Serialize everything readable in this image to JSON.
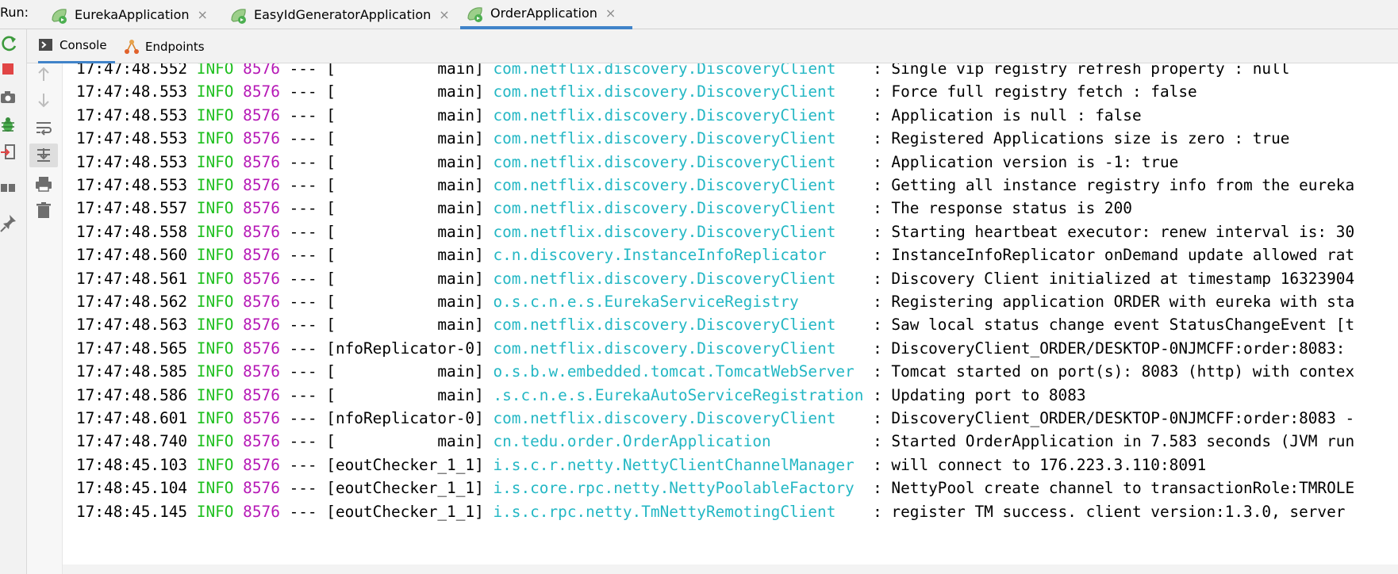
{
  "run_bar": {
    "label": "Run:",
    "tabs": [
      {
        "label": "EurekaApplication",
        "close": "×",
        "icon": "spring-boot-app-icon"
      },
      {
        "label": "EasyIdGeneratorApplication",
        "close": "×",
        "icon": "spring-boot-app-icon"
      },
      {
        "label": "OrderApplication",
        "close": "×",
        "icon": "spring-boot-app-icon",
        "active": true
      }
    ]
  },
  "sub_tabs": [
    {
      "label": "Console",
      "icon": "console-icon",
      "active": true
    },
    {
      "label": "Endpoints",
      "icon": "endpoints-icon"
    }
  ],
  "left_toolbar": [
    "rerun-icon",
    "stop-icon",
    "camera-icon",
    "debug-icon",
    "exit-icon",
    "layout-icon",
    "pin-icon"
  ],
  "console_toolbar": [
    "up-arrow-icon",
    "down-arrow-icon",
    "soft-wrap-icon",
    "scroll-to-end-icon",
    "print-icon",
    "trash-icon"
  ],
  "colors": {
    "accent": "#4083c9",
    "log_level": "#1ebf1e",
    "pid": "#b618b6",
    "logger": "#23b7c4"
  },
  "console": {
    "lines": [
      {
        "time": "17:47:48.552",
        "level": "INFO",
        "pid": "8576",
        "sep": "---",
        "thread": "[           main]",
        "logger": "com.netflix.discovery.DiscoveryClient    ",
        "message": ": Single vip registry refresh property : null"
      },
      {
        "time": "17:47:48.553",
        "level": "INFO",
        "pid": "8576",
        "sep": "---",
        "thread": "[           main]",
        "logger": "com.netflix.discovery.DiscoveryClient    ",
        "message": ": Force full registry fetch : false"
      },
      {
        "time": "17:47:48.553",
        "level": "INFO",
        "pid": "8576",
        "sep": "---",
        "thread": "[           main]",
        "logger": "com.netflix.discovery.DiscoveryClient    ",
        "message": ": Application is null : false"
      },
      {
        "time": "17:47:48.553",
        "level": "INFO",
        "pid": "8576",
        "sep": "---",
        "thread": "[           main]",
        "logger": "com.netflix.discovery.DiscoveryClient    ",
        "message": ": Registered Applications size is zero : true"
      },
      {
        "time": "17:47:48.553",
        "level": "INFO",
        "pid": "8576",
        "sep": "---",
        "thread": "[           main]",
        "logger": "com.netflix.discovery.DiscoveryClient    ",
        "message": ": Application version is -1: true"
      },
      {
        "time": "17:47:48.553",
        "level": "INFO",
        "pid": "8576",
        "sep": "---",
        "thread": "[           main]",
        "logger": "com.netflix.discovery.DiscoveryClient    ",
        "message": ": Getting all instance registry info from the eureka"
      },
      {
        "time": "17:47:48.557",
        "level": "INFO",
        "pid": "8576",
        "sep": "---",
        "thread": "[           main]",
        "logger": "com.netflix.discovery.DiscoveryClient    ",
        "message": ": The response status is 200"
      },
      {
        "time": "17:47:48.558",
        "level": "INFO",
        "pid": "8576",
        "sep": "---",
        "thread": "[           main]",
        "logger": "com.netflix.discovery.DiscoveryClient    ",
        "message": ": Starting heartbeat executor: renew interval is: 30"
      },
      {
        "time": "17:47:48.560",
        "level": "INFO",
        "pid": "8576",
        "sep": "---",
        "thread": "[           main]",
        "logger": "c.n.discovery.InstanceInfoReplicator     ",
        "message": ": InstanceInfoReplicator onDemand update allowed rat"
      },
      {
        "time": "17:47:48.561",
        "level": "INFO",
        "pid": "8576",
        "sep": "---",
        "thread": "[           main]",
        "logger": "com.netflix.discovery.DiscoveryClient    ",
        "message": ": Discovery Client initialized at timestamp 16323904"
      },
      {
        "time": "17:47:48.562",
        "level": "INFO",
        "pid": "8576",
        "sep": "---",
        "thread": "[           main]",
        "logger": "o.s.c.n.e.s.EurekaServiceRegistry        ",
        "message": ": Registering application ORDER with eureka with sta"
      },
      {
        "time": "17:47:48.563",
        "level": "INFO",
        "pid": "8576",
        "sep": "---",
        "thread": "[           main]",
        "logger": "com.netflix.discovery.DiscoveryClient    ",
        "message": ": Saw local status change event StatusChangeEvent [t"
      },
      {
        "time": "17:47:48.565",
        "level": "INFO",
        "pid": "8576",
        "sep": "---",
        "thread": "[nfoReplicator-0]",
        "logger": "com.netflix.discovery.DiscoveryClient    ",
        "message": ": DiscoveryClient_ORDER/DESKTOP-0NJMCFF:order:8083: "
      },
      {
        "time": "17:47:48.585",
        "level": "INFO",
        "pid": "8576",
        "sep": "---",
        "thread": "[           main]",
        "logger": "o.s.b.w.embedded.tomcat.TomcatWebServer  ",
        "message": ": Tomcat started on port(s): 8083 (http) with contex"
      },
      {
        "time": "17:47:48.586",
        "level": "INFO",
        "pid": "8576",
        "sep": "---",
        "thread": "[           main]",
        "logger": ".s.c.n.e.s.EurekaAutoServiceRegistration ",
        "message": ": Updating port to 8083"
      },
      {
        "time": "17:47:48.601",
        "level": "INFO",
        "pid": "8576",
        "sep": "---",
        "thread": "[nfoReplicator-0]",
        "logger": "com.netflix.discovery.DiscoveryClient    ",
        "message": ": DiscoveryClient_ORDER/DESKTOP-0NJMCFF:order:8083 -"
      },
      {
        "time": "17:47:48.740",
        "level": "INFO",
        "pid": "8576",
        "sep": "---",
        "thread": "[           main]",
        "logger": "cn.tedu.order.OrderApplication           ",
        "message": ": Started OrderApplication in 7.583 seconds (JVM run"
      },
      {
        "time": "17:48:45.103",
        "level": "INFO",
        "pid": "8576",
        "sep": "---",
        "thread": "[eoutChecker_1_1]",
        "logger": "i.s.c.r.netty.NettyClientChannelManager  ",
        "message": ": will connect to 176.223.3.110:8091"
      },
      {
        "time": "17:48:45.104",
        "level": "INFO",
        "pid": "8576",
        "sep": "---",
        "thread": "[eoutChecker_1_1]",
        "logger": "i.s.core.rpc.netty.NettyPoolableFactory  ",
        "message": ": NettyPool create channel to transactionRole:TMROLE"
      },
      {
        "time": "17:48:45.145",
        "level": "INFO",
        "pid": "8576",
        "sep": "---",
        "thread": "[eoutChecker_1_1]",
        "logger": "i.s.c.rpc.netty.TmNettyRemotingClient    ",
        "message": ": register TM success. client version:1.3.0, server"
      }
    ]
  }
}
